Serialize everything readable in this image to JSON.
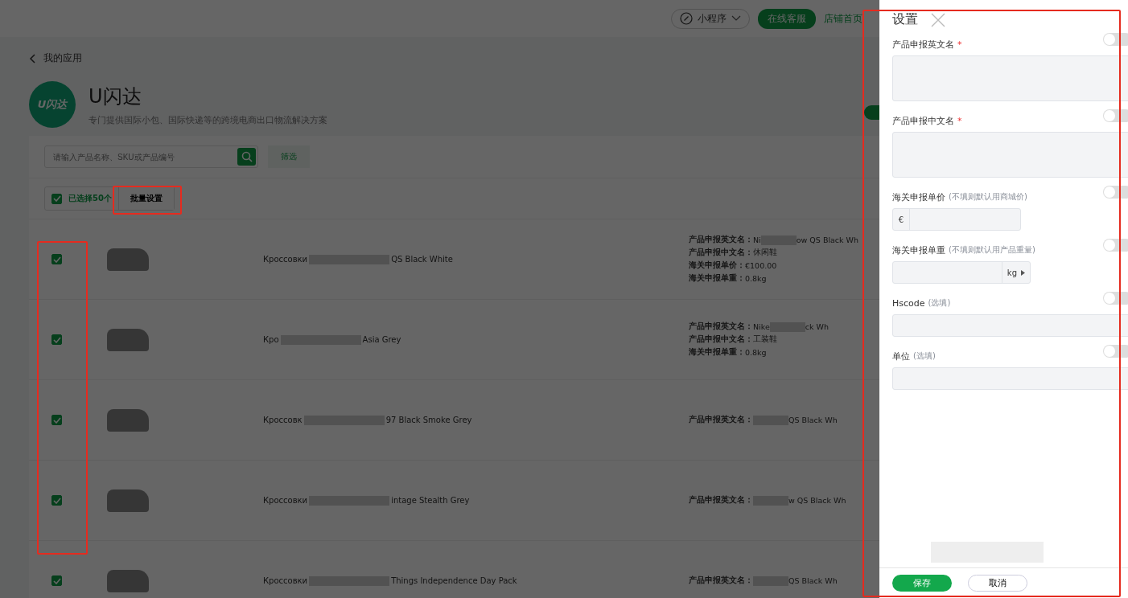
{
  "topbar": {
    "mini_program": "小程序",
    "service_button": "在线客服",
    "shop_link": "店铺首页"
  },
  "back_link": "我的应用",
  "app": {
    "logo_text": "U闪达",
    "title": "U闪达",
    "subtitle": "专门提供国际小包、国际快递等的跨境电商出口物流解决方案"
  },
  "search": {
    "placeholder": "请输入产品名称、SKU或产品编号"
  },
  "filter_button": "筛选",
  "selection": {
    "checked": true,
    "label": "已选择50个",
    "batch_button": "批量设置"
  },
  "rows": [
    {
      "checked": true,
      "name_start": "Кроссовки",
      "name_end": "QS Black White",
      "details": [
        {
          "label": "产品申报英文名：",
          "value_start": "Ni",
          "value_end": "ow QS Black Wh"
        },
        {
          "label": "产品申报中文名：",
          "value_start": "休闲鞋"
        },
        {
          "label": "海关申报单价：",
          "value_start": "€100.00"
        },
        {
          "label": "海关申报单重：",
          "value_start": "0.8kg"
        }
      ]
    },
    {
      "checked": true,
      "name_start": "Кро",
      "name_end": "Asia Grey",
      "details": [
        {
          "label": "产品申报英文名：",
          "value_start": "Nike",
          "value_end": "ck Wh"
        },
        {
          "label": "产品申报中文名：",
          "value_start": "工装鞋"
        },
        {
          "label": "海关申报单重：",
          "value_start": "0.8kg"
        }
      ]
    },
    {
      "checked": true,
      "name_start": "Кроссовк",
      "name_end": "97 Black Smoke Grey",
      "details": [
        {
          "label": "产品申报英文名：",
          "value_end": "QS Black Wh"
        }
      ]
    },
    {
      "checked": true,
      "name_start": "Кроссовки",
      "name_end": "intage Stealth Grey",
      "details": [
        {
          "label": "产品申报英文名：",
          "value_end": "w QS Black Wh"
        }
      ]
    },
    {
      "checked": true,
      "name_start": "Кроссовки",
      "name_end": "Things Independence Day Pack",
      "details": [
        {
          "label": "产品申报英文名：",
          "value_end": "QS Black Wh"
        }
      ]
    }
  ],
  "drawer": {
    "title": "设置",
    "fields": [
      {
        "kind": "textarea",
        "label": "产品申报英文名",
        "required_mark": "*",
        "on": false
      },
      {
        "kind": "textarea",
        "label": "产品申报中文名",
        "required_mark": "*",
        "on": false
      },
      {
        "kind": "prefixed",
        "label": "海关申报单价",
        "hint": "(不填则默认用商城价)",
        "prefix": "€",
        "on": false
      },
      {
        "kind": "unit",
        "label": "海关申报单重",
        "hint": "(不填则默认用产品重量)",
        "unit": "kg",
        "on": false
      },
      {
        "kind": "input",
        "label": "Hscode",
        "hint": "(选填)",
        "on": false
      },
      {
        "kind": "input",
        "label": "单位",
        "hint": "(选填)",
        "on": false
      }
    ],
    "save_button": "保存",
    "cancel_button": "取消"
  }
}
